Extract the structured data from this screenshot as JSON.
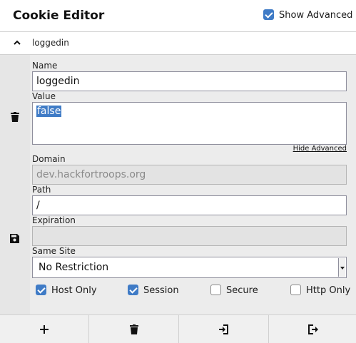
{
  "header": {
    "title": "Cookie Editor",
    "show_advanced_label": "Show Advanced",
    "show_advanced_checked": true
  },
  "cookie": {
    "name": "loggedin",
    "expanded": true
  },
  "fields": {
    "name_label": "Name",
    "name_value": "loggedin",
    "value_label": "Value",
    "value_value": "false",
    "hide_advanced": "Hide Advanced",
    "domain_label": "Domain",
    "domain_value": "dev.hackfortroops.org",
    "path_label": "Path",
    "path_value": "/",
    "expiration_label": "Expiration",
    "expiration_value": "",
    "same_site_label": "Same Site",
    "same_site_value": "No Restriction"
  },
  "flags": [
    {
      "label": "Host Only",
      "checked": true
    },
    {
      "label": "Session",
      "checked": true
    },
    {
      "label": "Secure",
      "checked": false
    },
    {
      "label": "Http Only",
      "checked": false
    }
  ],
  "icons": {
    "collapse": "chevron-up-icon",
    "delete": "trash-icon",
    "save": "floppy-disk-icon",
    "add": "plus-icon",
    "delete_all": "trash-icon",
    "import": "import-icon",
    "export": "export-icon"
  },
  "colors": {
    "accent": "#3f7bc6"
  }
}
